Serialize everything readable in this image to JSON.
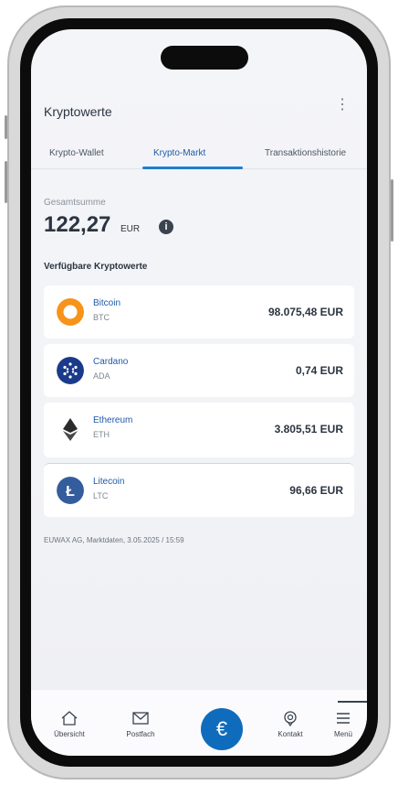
{
  "app": {
    "title": "Kryptowerte",
    "menu_icon": "kebab-vertical-icon"
  },
  "tabs": [
    {
      "label": "Krypto-Wallet",
      "active": false
    },
    {
      "label": "Krypto-Markt",
      "active": true
    },
    {
      "label": "Transaktionshistorie",
      "active": false
    }
  ],
  "summary": {
    "label": "Gesamtsumme",
    "value": "122,27",
    "currency": "EUR",
    "info_icon": "info-icon"
  },
  "assets": {
    "section_title": "Verfügbare Kryptowerte",
    "items": [
      {
        "name": "Bitcoin",
        "symbol": "BTC",
        "price": "98.075,48 EUR",
        "icon": "bitcoin-icon",
        "color": "#f7931a"
      },
      {
        "name": "Cardano",
        "symbol": "ADA",
        "price": "0,74 EUR",
        "icon": "cardano-icon",
        "color": "#1b3a8a"
      },
      {
        "name": "Ethereum",
        "symbol": "ETH",
        "price": "3.805,51 EUR",
        "icon": "ethereum-icon",
        "color": "#2b2b2b"
      },
      {
        "name": "Litecoin",
        "symbol": "LTC",
        "price": "96,66 EUR",
        "icon": "litecoin-icon",
        "color": "#345d9d"
      }
    ]
  },
  "footnote": "EUWAX AG, Marktdaten, 3.05.2025 / 15:59",
  "nav": [
    {
      "label": "Übersicht",
      "icon": "home-icon"
    },
    {
      "label": "Postfach",
      "icon": "mail-icon"
    },
    {
      "label": "",
      "icon": "euro-icon"
    },
    {
      "label": "Kontakt",
      "icon": "support-icon"
    },
    {
      "label": "Menü",
      "icon": "menu-icon"
    }
  ],
  "colors": {
    "accent": "#0f6cbd",
    "tab_underline": "#1f7fd1",
    "link": "#1e5aa8"
  }
}
